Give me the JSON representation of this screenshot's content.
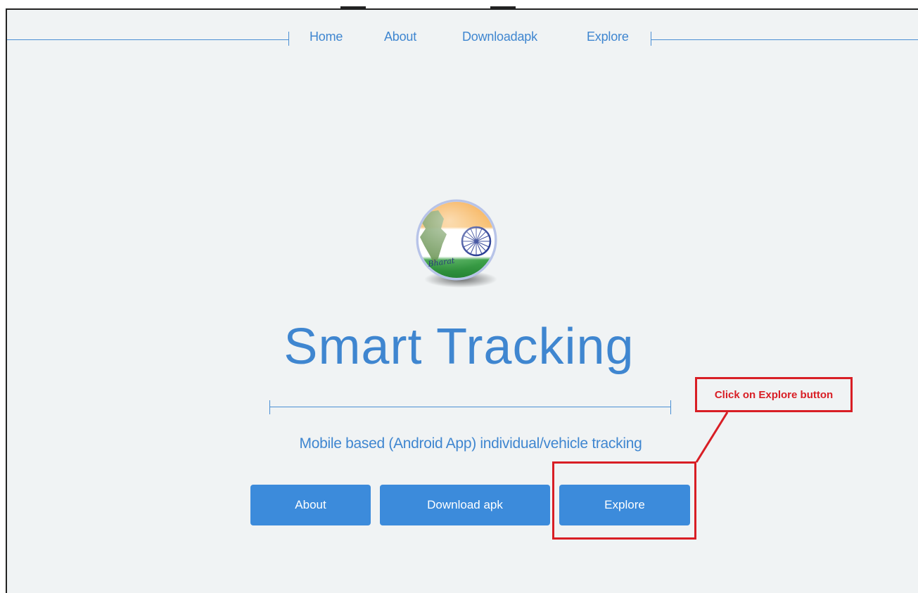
{
  "nav": {
    "items": [
      {
        "label": "Home"
      },
      {
        "label": "About"
      },
      {
        "label": "Downloadapk"
      },
      {
        "label": "Explore"
      }
    ]
  },
  "logo": {
    "icon": "india-globe-logo-icon",
    "text": "Bharat"
  },
  "hero": {
    "title": "Smart Tracking",
    "subtitle": "Mobile based (Android App) individual/vehicle tracking"
  },
  "buttons": {
    "about": "About",
    "download": "Download apk",
    "explore": "Explore"
  },
  "annotation": {
    "label": "Click on Explore button",
    "color": "#d81e25"
  },
  "colors": {
    "accent": "#3f86d0",
    "button": "#3c8bdb",
    "background": "#f0f3f4"
  }
}
